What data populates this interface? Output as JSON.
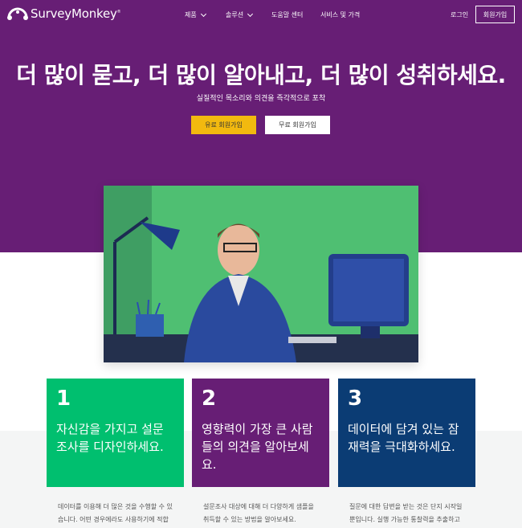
{
  "nav": {
    "logo_text": "SurveyMonkey",
    "logo_mark": "®",
    "items": [
      {
        "label": "제품",
        "has_dropdown": true
      },
      {
        "label": "솔루션",
        "has_dropdown": true
      },
      {
        "label": "도움말 센터",
        "has_dropdown": false
      },
      {
        "label": "서비스 및 가격",
        "has_dropdown": false
      }
    ],
    "login_label": "로그인",
    "signup_label": "회원가입"
  },
  "hero": {
    "headline": "더 많이 묻고, 더 많이 알아내고, 더 많이 성취하세요.",
    "subheadline": "실질적인 목소리와 의견을 즉각적으로 포착",
    "paid_signup_label": "유료 회원가입",
    "free_signup_label": "무료 회원가입"
  },
  "cards": [
    {
      "number": "1",
      "title": "자신감을 가지고 설문 조사를 디자인하세요.",
      "description": "데이터를 이용해 더 많은 것을 수행할 수 있습니다. 어떤 경우에라도 사용하기에 적합한 수천건의 설문조사를 통해 시행"
    },
    {
      "number": "2",
      "title": "영향력이 가장 큰 사람들의 의견을 알아보세요.",
      "description": "설문조사 대상에 대해 더 다양하게 샘플을 취득할 수 있는 방법을 알아보세요. SurveyMonkey의 설문조사 컬렉터를"
    },
    {
      "number": "3",
      "title": "데이터에 담겨 있는 잠재력을 극대화하세요.",
      "description": "질문에 대한 답변을 받는 것은 단지 시작일 뿐입니다. 실행 가능한 통찰력을 추출하고 팀과 공유하여 비즈니스를 향후 더"
    }
  ],
  "colors": {
    "hero_bg": "#671e75",
    "accent_yellow": "#f2b90f",
    "card_green": "#00bf6f",
    "card_purple": "#671e75",
    "card_navy": "#0b3c74"
  }
}
